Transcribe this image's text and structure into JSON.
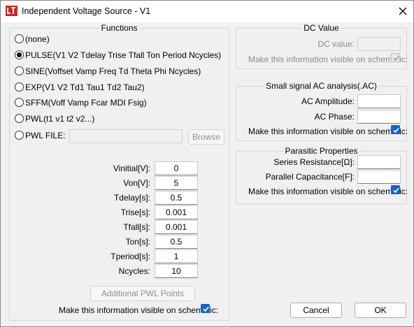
{
  "window": {
    "title": "Independent Voltage Source - V1"
  },
  "functions": {
    "legend": "Functions",
    "options": [
      {
        "label": "(none)",
        "checked": false
      },
      {
        "label": "PULSE(V1 V2 Tdelay Trise Tfall Ton Period Ncycles)",
        "checked": true
      },
      {
        "label": "SINE(Voffset Vamp Freq Td Theta Phi Ncycles)",
        "checked": false
      },
      {
        "label": "EXP(V1 V2 Td1 Tau1 Td2 Tau2)",
        "checked": false
      },
      {
        "label": "SFFM(Voff Vamp Fcar MDI Fsig)",
        "checked": false
      },
      {
        "label": "PWL(t1 v1 t2 v2...)",
        "checked": false
      },
      {
        "label": "PWL FILE:",
        "checked": false
      }
    ],
    "pwl_file_value": "",
    "browse_label": "Browse",
    "params": [
      {
        "label": "Vinitial[V]:",
        "value": "0"
      },
      {
        "label": "Von[V]:",
        "value": "5"
      },
      {
        "label": "Tdelay[s]:",
        "value": "0.5"
      },
      {
        "label": "Trise[s]:",
        "value": "0.001"
      },
      {
        "label": "Tfall[s]:",
        "value": "0.001"
      },
      {
        "label": "Ton[s]:",
        "value": "0.5"
      },
      {
        "label": "Tperiod[s]:",
        "value": "1"
      },
      {
        "label": "Ncycles:",
        "value": "10"
      }
    ],
    "additional_pwl_label": "Additional PWL Points",
    "visible_label": "Make this information visible on schematic:",
    "visible_checked": true
  },
  "dc": {
    "legend": "DC Value",
    "dc_value_label": "DC value:",
    "dc_value": "",
    "visible_label": "Make this information visible on schematic:",
    "visible_checked": true
  },
  "ac": {
    "legend": "Small signal AC analysis(.AC)",
    "amplitude_label": "AC Amplitude:",
    "amplitude_value": "",
    "phase_label": "AC Phase:",
    "phase_value": "",
    "visible_label": "Make this information visible on schematic:",
    "visible_checked": true
  },
  "parasitic": {
    "legend": "Parasitic Properties",
    "series_label": "Series Resistance[Ω]:",
    "series_value": "",
    "parallel_label": "Parallel Capacitance[F]:",
    "parallel_value": "",
    "visible_label": "Make this information visible on schematic:",
    "visible_checked": true
  },
  "buttons": {
    "cancel": "Cancel",
    "ok": "OK"
  },
  "colors": {
    "checkbox_blue": "#1a63c6",
    "app_icon_red": "#c62828"
  }
}
